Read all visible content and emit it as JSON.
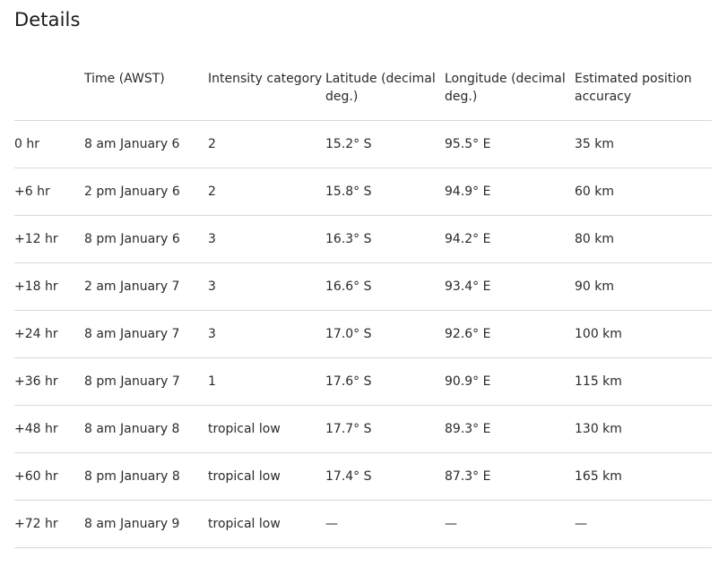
{
  "heading": "Details",
  "table": {
    "headers": [
      "",
      "Time (AWST)",
      "Intensity category",
      "Latitude (decimal deg.)",
      "Longitude (decimal deg.)",
      "Estimated position accuracy"
    ],
    "rows": [
      [
        "0 hr",
        "8 am January 6",
        "2",
        "15.2° S",
        "95.5° E",
        "35 km"
      ],
      [
        "+6 hr",
        "2 pm January 6",
        "2",
        "15.8° S",
        "94.9° E",
        "60 km"
      ],
      [
        "+12 hr",
        "8 pm January 6",
        "3",
        "16.3° S",
        "94.2° E",
        "80 km"
      ],
      [
        "+18 hr",
        "2 am January 7",
        "3",
        "16.6° S",
        "93.4° E",
        "90 km"
      ],
      [
        "+24 hr",
        "8 am January 7",
        "3",
        "17.0° S",
        "92.6° E",
        "100 km"
      ],
      [
        "+36 hr",
        "8 pm January 7",
        "1",
        "17.6° S",
        "90.9° E",
        "115 km"
      ],
      [
        "+48 hr",
        "8 am January 8",
        "tropical low",
        "17.7° S",
        "89.3° E",
        "130 km"
      ],
      [
        "+60 hr",
        "8 pm January 8",
        "tropical low",
        "17.4° S",
        "87.3° E",
        "165 km"
      ],
      [
        "+72 hr",
        "8 am January 9",
        "tropical low",
        "—",
        "—",
        "—"
      ]
    ]
  }
}
